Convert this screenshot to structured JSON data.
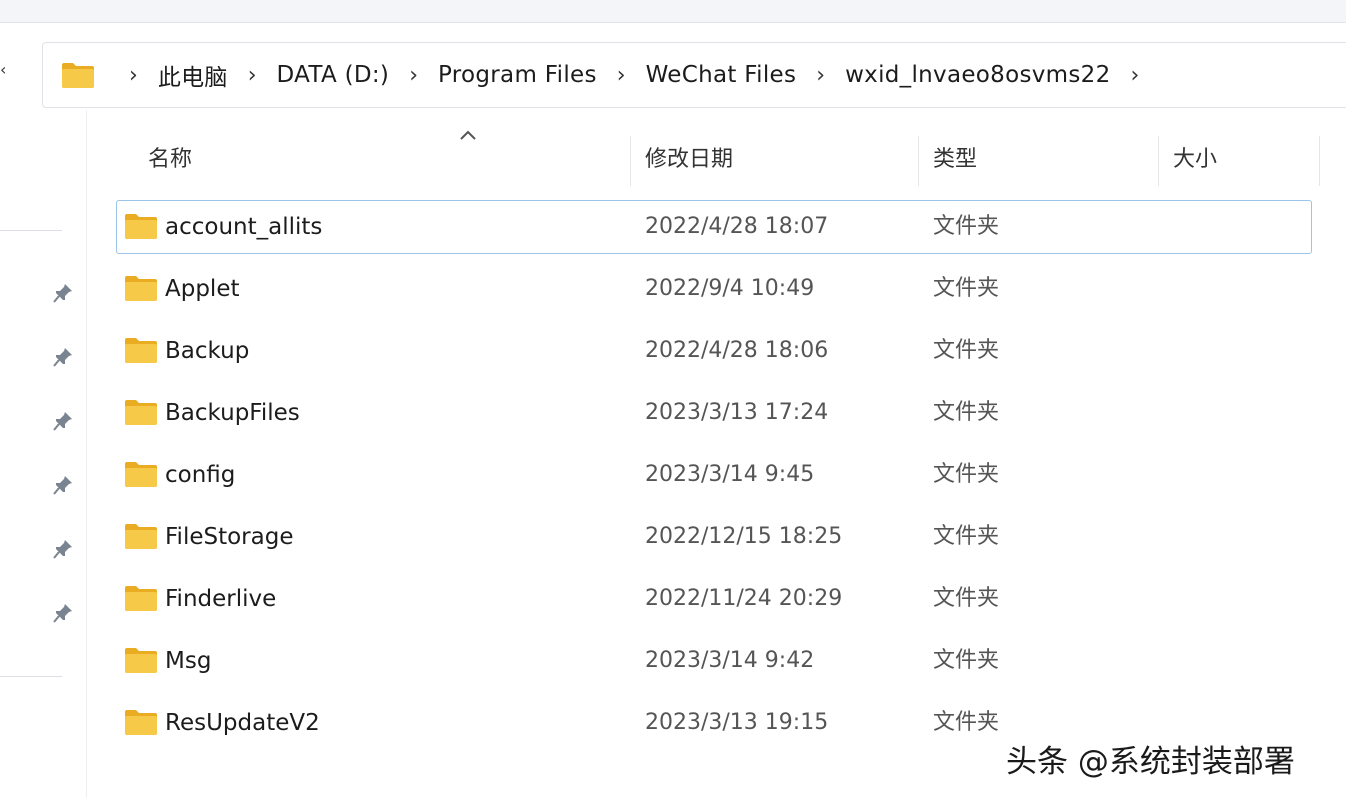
{
  "breadcrumb": {
    "items": [
      "此电脑",
      "DATA (D:)",
      "Program Files",
      "WeChat Files",
      "wxid_lnvaeo8osvms22"
    ],
    "separator": "›"
  },
  "columns": {
    "name": "名称",
    "modified": "修改日期",
    "type": "类型",
    "size": "大小"
  },
  "files": [
    {
      "name": "account_allits",
      "modified": "2022/4/28 18:07",
      "type": "文件夹"
    },
    {
      "name": "Applet",
      "modified": "2022/9/4 10:49",
      "type": "文件夹"
    },
    {
      "name": "Backup",
      "modified": "2022/4/28 18:06",
      "type": "文件夹"
    },
    {
      "name": "BackupFiles",
      "modified": "2023/3/13 17:24",
      "type": "文件夹"
    },
    {
      "name": "config",
      "modified": "2023/3/14 9:45",
      "type": "文件夹"
    },
    {
      "name": "FileStorage",
      "modified": "2022/12/15 18:25",
      "type": "文件夹"
    },
    {
      "name": "Finderlive",
      "modified": "2022/11/24 20:29",
      "type": "文件夹"
    },
    {
      "name": "Msg",
      "modified": "2023/3/14 9:42",
      "type": "文件夹"
    },
    {
      "name": "ResUpdateV2",
      "modified": "2023/3/13 19:15",
      "type": "文件夹"
    }
  ],
  "watermark": "头条 @系统封装部署",
  "colors": {
    "folder": "#f7c948",
    "folder_dark": "#e9ac22",
    "focus_border": "#9cc3ea",
    "pin": "#7a8490"
  },
  "icons": {
    "folder": "folder-icon",
    "pin": "pin-icon",
    "chevron": "chevron-right-icon",
    "sort": "sort-ascending-icon"
  }
}
